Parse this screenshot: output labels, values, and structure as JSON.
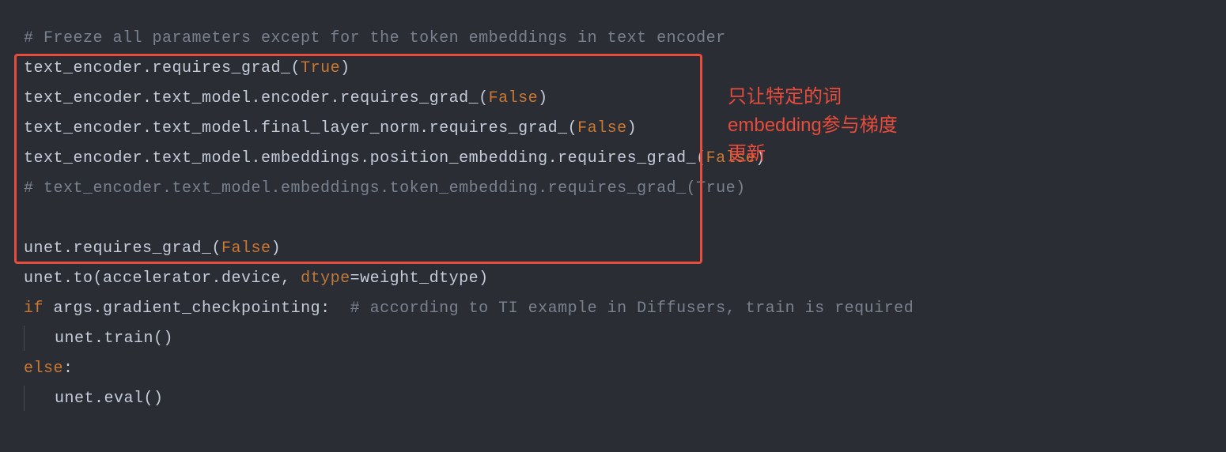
{
  "code": {
    "line1_comment": "# Freeze all parameters except for the token embeddings in text encoder",
    "line2_pre": "text_encoder.requires_grad_(",
    "line2_val": "True",
    "line2_post": ")",
    "line3_pre": "text_encoder.text_model.encoder.requires_grad_(",
    "line3_val": "False",
    "line3_post": ")",
    "line4_pre": "text_encoder.text_model.final_layer_norm.requires_grad_(",
    "line4_val": "False",
    "line4_post": ")",
    "line5_pre": "text_encoder.text_model.embeddings.position_embedding.requires_grad_(",
    "line5_val": "False",
    "line5_post": ")",
    "line6_comment": "# text_encoder.text_model.embeddings.token_embedding.requires_grad_(True)",
    "line7_blank": "",
    "line8_pre": "unet.requires_grad_(",
    "line8_val": "False",
    "line8_post": ")",
    "line9_pre": "unet.to(accelerator.device, ",
    "line9_arg": "dtype",
    "line9_mid": "=weight_dtype)",
    "line10_kw": "if",
    "line10_cond": " args.gradient_checkpointing:  ",
    "line10_comment": "# according to TI example in Diffusers, train is required",
    "line11_body": "unet.train()",
    "line12_kw": "else",
    "line12_post": ":",
    "line13_body": "unet.eval()"
  },
  "annotation": {
    "line1": "只让特定的词",
    "line2": "embedding参与梯度",
    "line3": "更新"
  }
}
